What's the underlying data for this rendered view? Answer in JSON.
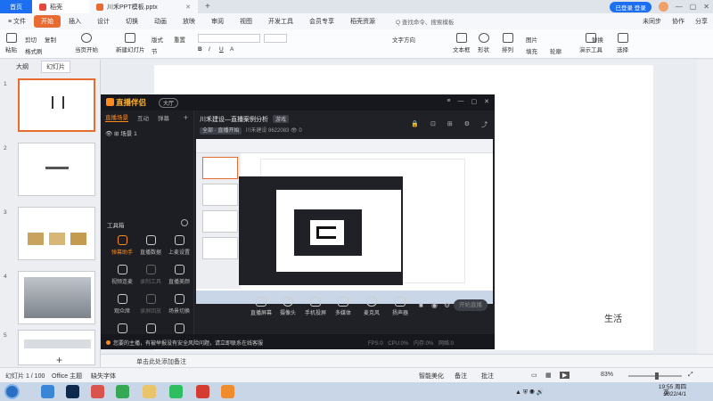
{
  "tabs": {
    "home": "首页",
    "doc": "稻壳",
    "file": "川禾PPT模板.pptx",
    "new_tab": "+"
  },
  "window": {
    "login": "已登录 登录",
    "minimize": "—",
    "maximize": "▢",
    "close": "✕"
  },
  "menu": {
    "file": "≡ 文件",
    "items": [
      "开始",
      "插入",
      "设计",
      "切换",
      "动画",
      "放映",
      "审阅",
      "视图",
      "开发工具",
      "会员专享",
      "稻壳资源"
    ],
    "active": "开始",
    "search": "Q 查找命令、搜索模板",
    "right": [
      "未同步",
      "协作",
      "分享"
    ]
  },
  "ribbon": {
    "paste": "粘贴",
    "cut": "剪切",
    "copy": "复制",
    "format_painter": "格式刷",
    "play": "当页开始",
    "new_slide": "新建幻灯片",
    "layout": "版式",
    "section": "节",
    "reset": "重置",
    "text_direction": "文字方向",
    "textbox": "文本框",
    "shape": "形状",
    "arrange": "排列",
    "outline": "轮廓",
    "presenter": "演示工具",
    "replace": "替换",
    "select": "选择",
    "picture": "图片",
    "fill": "填充"
  },
  "left_pane": {
    "tabs": [
      "大纲",
      "幻灯片"
    ],
    "active_tab": "幻灯片",
    "slide_numbers": [
      "1",
      "2",
      "3",
      "4",
      "5"
    ],
    "add_slide": "+"
  },
  "slide": {
    "tail_text": "生活"
  },
  "notes": {
    "placeholder": "单击此处添加备注"
  },
  "status": {
    "slide_count": "幻灯片 1 / 100",
    "theme": "Office 主题",
    "missing_font": "缺失字体",
    "beautify": "智能美化",
    "notes": "备注",
    "comments": "批注",
    "zoom": "83%"
  },
  "taskbar": {
    "time": "19:55 周四",
    "date": "2022/4/1",
    "lang": "英"
  },
  "live": {
    "logo": "直播伴侣",
    "hall_badge": "大厅",
    "left_tabs": [
      "直播场景",
      "互动",
      "弹幕"
    ],
    "active_left_tab": "直播场景",
    "scene": "👁  ⊞  场景 1",
    "toolbox": "工具箱",
    "tools": [
      {
        "label": "弹幕助手",
        "state": "on"
      },
      {
        "label": "直播数据",
        "state": "normal"
      },
      {
        "label": "上麦设置",
        "state": "normal"
      },
      {
        "label": "视频连麦",
        "state": "normal"
      },
      {
        "label": "录制工具",
        "state": "dim"
      },
      {
        "label": "直播美颜",
        "state": "normal"
      },
      {
        "label": "观众席",
        "state": "normal"
      },
      {
        "label": "录屏回放",
        "state": "dim"
      },
      {
        "label": "场景切换",
        "state": "normal"
      },
      {
        "label": "",
        "state": "normal"
      },
      {
        "label": "",
        "state": "normal"
      },
      {
        "label": "",
        "state": "normal"
      }
    ],
    "room_title": "川禾建设—直播案例分析",
    "room_tag": "游戏",
    "room_meta_pill": "全部 · 直播开始",
    "room_meta": "川禾建设 8622083  👁 0",
    "controls": [
      "直播屏幕",
      "摄像头",
      "手机投屏",
      "多媒体",
      "麦克风",
      "扬声器"
    ],
    "go_live": "开始直播",
    "warning": "您要的主播，有被举报没有安全风险问题，请立即联系在线客服",
    "stats": "FPS:0  CPU:0%  内存:0%  网络:0"
  }
}
